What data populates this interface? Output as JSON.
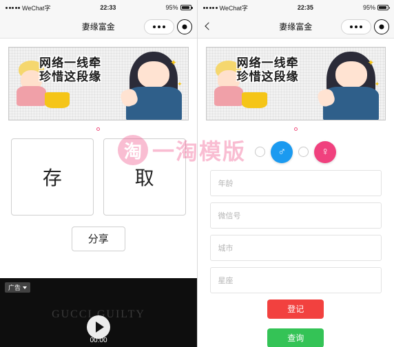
{
  "left": {
    "status": {
      "carrier": "WeChat字",
      "time": "22:33",
      "battery_pct": "95%"
    },
    "nav": {
      "title": "妻缘富金",
      "menu_icon": "ellipsis-icon",
      "close_icon": "target-icon"
    },
    "banner": {
      "line1": "网络一线牵",
      "line2": "珍惜这段缘"
    },
    "buttons": {
      "save": "存",
      "take": "取",
      "share": "分享"
    },
    "video": {
      "ad_label": "广告",
      "brand": "GUCCI GUILTY",
      "time": "00:00",
      "play_icon": "play-icon"
    }
  },
  "right": {
    "status": {
      "carrier": "WeChat字",
      "time": "22:35",
      "battery_pct": "95%"
    },
    "nav": {
      "title": "妻缘富金",
      "back_icon": "chevron-left-icon",
      "menu_icon": "ellipsis-icon",
      "close_icon": "target-icon"
    },
    "banner": {
      "line1": "网络一线牵",
      "line2": "珍惜这段缘"
    },
    "gender": {
      "male_icon": "♂",
      "female_icon": "♀"
    },
    "fields": [
      {
        "name": "age",
        "placeholder": "年龄"
      },
      {
        "name": "wechat-id",
        "placeholder": "微信号"
      },
      {
        "name": "city",
        "placeholder": "城市"
      },
      {
        "name": "zodiac",
        "placeholder": "星座"
      }
    ],
    "buttons": {
      "register": "登记",
      "query": "查询"
    }
  },
  "watermark": {
    "logo_char": "淘",
    "text": "一淘模版"
  },
  "colors": {
    "accent_pink": "#f0417e",
    "accent_blue": "#1b9af0",
    "red": "#f2413f",
    "green": "#34c356"
  }
}
